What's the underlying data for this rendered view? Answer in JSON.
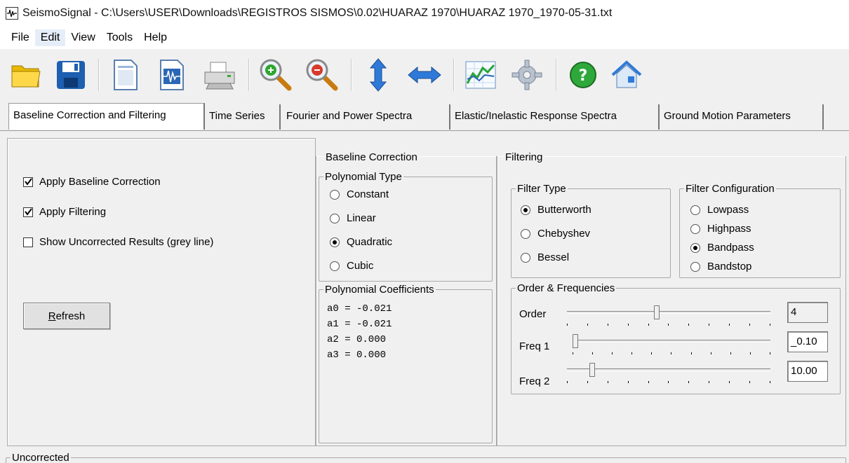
{
  "window": {
    "title": "SeismoSignal - C:\\Users\\USER\\Downloads\\REGISTROS SISMOS\\0.02\\HUARAZ 1970\\HUARAZ 1970_1970-05-31.txt"
  },
  "menu": [
    "File",
    "Edit",
    "View",
    "Tools",
    "Help"
  ],
  "toolbar": {
    "icons": [
      "open-folder-icon",
      "save-icon",
      "document-icon",
      "signal-document-icon",
      "print-icon",
      "zoom-in-icon",
      "zoom-out-icon",
      "vertical-arrows-icon",
      "horizontal-arrows-icon",
      "chart-icon",
      "settings-gear-icon",
      "help-icon",
      "home-icon"
    ]
  },
  "tabs": [
    "Baseline Correction and Filtering",
    "Time Series",
    "Fourier and Power Spectra",
    "Elastic/Inelastic Response Spectra",
    "Ground Motion Parameters"
  ],
  "options": {
    "apply_baseline": "Apply Baseline Correction",
    "apply_filtering": "Apply Filtering",
    "show_uncorrected": "Show Uncorrected Results (grey line)",
    "refresh": "Refresh"
  },
  "baseline": {
    "title": "Baseline Correction",
    "poly_type_title": "Polynomial Type",
    "types": [
      "Constant",
      "Linear",
      "Quadratic",
      "Cubic"
    ],
    "selected": "Quadratic",
    "coef_title": "Polynomial Coefficients",
    "coefficients": [
      "a0 = -0.021",
      "a1 = -0.021",
      "a2 = 0.000",
      "a3 = 0.000"
    ]
  },
  "filtering": {
    "title": "Filtering",
    "filter_type_title": "Filter Type",
    "filter_types": [
      "Butterworth",
      "Chebyshev",
      "Bessel"
    ],
    "filter_selected": "Butterworth",
    "config_title": "Filter Configuration",
    "configs": [
      "Lowpass",
      "Highpass",
      "Bandpass",
      "Bandstop"
    ],
    "config_selected": "Bandpass",
    "order_title": "Order & Frequencies",
    "order_label": "Order",
    "order_value": "4",
    "freq1_label": "Freq 1",
    "freq1_value": "_0.10",
    "freq2_label": "Freq 2",
    "freq2_value": "10.00"
  },
  "bottom": {
    "label": "Uncorrected"
  }
}
